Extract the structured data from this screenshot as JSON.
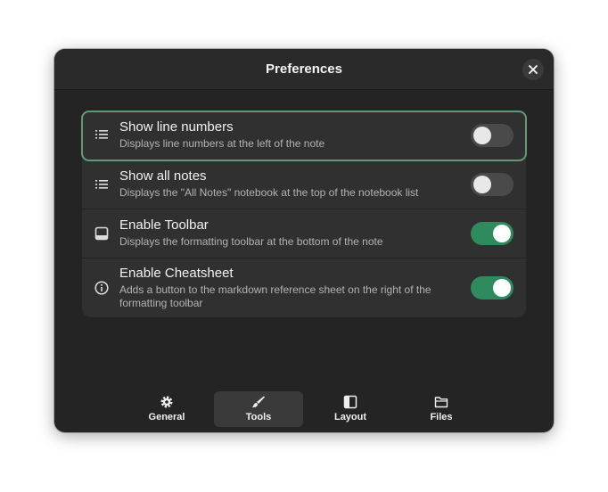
{
  "window": {
    "title": "Preferences"
  },
  "settings": [
    {
      "title": "Show line numbers",
      "subtitle": "Displays line numbers at the left of the note",
      "icon": "line-numbers-icon",
      "enabled": false
    },
    {
      "title": "Show all notes",
      "subtitle": "Displays the \"All Notes\" notebook at the top of the notebook list",
      "icon": "list-icon",
      "enabled": false
    },
    {
      "title": "Enable Toolbar",
      "subtitle": "Displays the formatting toolbar at the bottom of the note",
      "icon": "toolbar-icon",
      "enabled": true
    },
    {
      "title": "Enable Cheatsheet",
      "subtitle": "Adds a button to the markdown reference sheet on the right of the formatting toolbar",
      "icon": "info-icon",
      "enabled": true
    }
  ],
  "tabs": [
    {
      "label": "General",
      "icon": "gear-icon",
      "active": false
    },
    {
      "label": "Tools",
      "icon": "brush-icon",
      "active": true
    },
    {
      "label": "Layout",
      "icon": "layout-icon",
      "active": false
    },
    {
      "label": "Files",
      "icon": "folder-icon",
      "active": false
    }
  ],
  "colors": {
    "accent": "#2f8a5e",
    "focus_ring": "#5d9c7a",
    "window_bg": "#242424",
    "row_bg": "#303030"
  }
}
